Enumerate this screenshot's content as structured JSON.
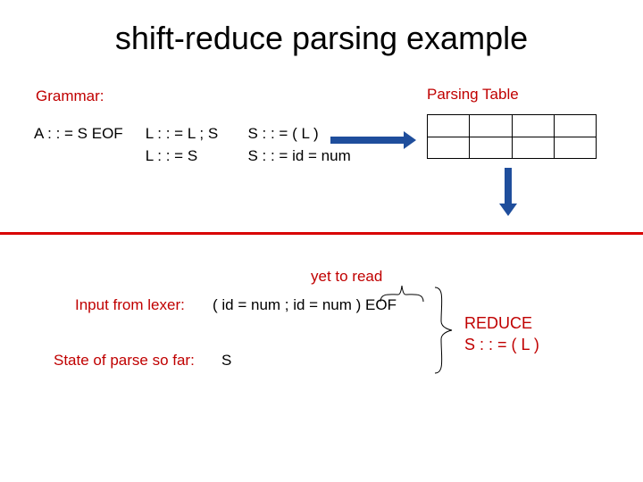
{
  "title": "shift-reduce parsing example",
  "labels": {
    "grammar": "Grammar:",
    "parsing_table": "Parsing Table",
    "yet_to_read": "yet to read",
    "input_from_lexer": "Input from lexer:",
    "state_of_parse": "State of parse so far:"
  },
  "grammar": {
    "a": "A : : = S EOF",
    "l1": "L : : = L ; S",
    "l2": "L : : = S",
    "s1": "S : : = ( L )",
    "s2": "S : : = id = num"
  },
  "input_value": "( id = num ; id = num ) EOF",
  "state_value": "S",
  "reduce": {
    "line1": "REDUCE",
    "line2": "S : : = ( L )"
  }
}
